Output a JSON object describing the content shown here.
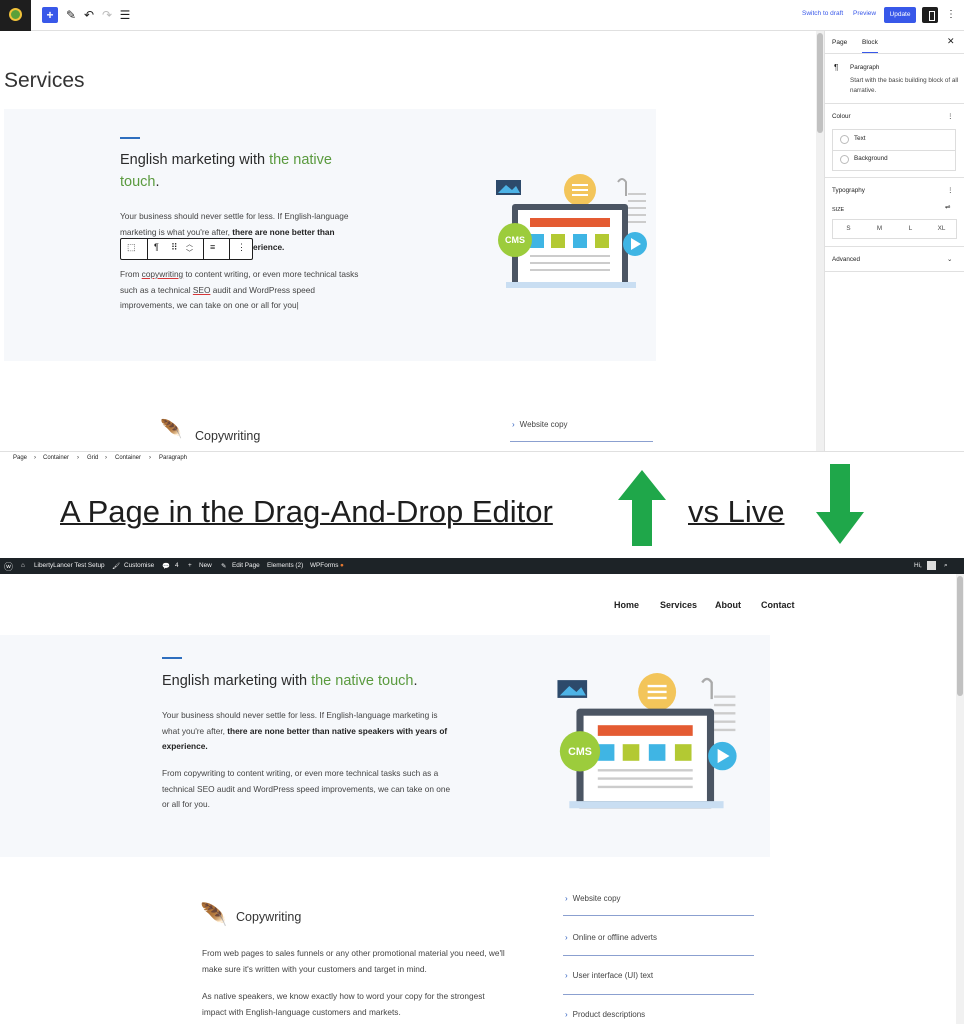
{
  "editor": {
    "toolbar": {
      "add_icon": "plus-icon",
      "switch_to_draft": "Switch to draft",
      "preview": "Preview",
      "update": "Update"
    },
    "page_title": "Services",
    "hero": {
      "heading_part1": "English marketing with ",
      "heading_green": "the native touch",
      "heading_end": ".",
      "para1_start": "Your business should never settle for less. If English-language marketing is what you're after, ",
      "para1_bold": "there are none better than",
      "para1_tail": "erience.",
      "para2_start": "From ",
      "para2_link1": "copywriting",
      "para2_mid1": " to content writing, or even more technical tasks such as a technical ",
      "para2_link2": "SEO",
      "para2_end": " audit and WordPress speed improvements, we can take on one or all for you"
    },
    "section": {
      "heading": "Copywriting",
      "list": [
        "Website copy"
      ]
    },
    "sidebar": {
      "tab_page": "Page",
      "tab_block": "Block",
      "block_name": "Paragraph",
      "block_desc": "Start with the basic building block of all narrative.",
      "colour_label": "Colour",
      "colour_text": "Text",
      "colour_background": "Background",
      "typography_label": "Typography",
      "size_label": "SIZE",
      "sizes": [
        "S",
        "M",
        "L",
        "XL"
      ],
      "advanced_label": "Advanced"
    },
    "breadcrumb": [
      "Page",
      "Container",
      "Grid",
      "Container",
      "Paragraph"
    ]
  },
  "caption": {
    "left": "A Page in the Drag-And-Drop Editor",
    "right": "vs Live",
    "up_color": "#1fa74a",
    "down_color": "#1fa74a"
  },
  "live": {
    "adminbar": {
      "site_name": "LibertyLancer Test Setup",
      "customise": "Customise",
      "comments": "4",
      "new": "New",
      "edit_page": "Edit Page",
      "elements": "Elements (2)",
      "wpforms": "WPForms",
      "greeting": "Hi,"
    },
    "nav": [
      "Home",
      "Services",
      "About",
      "Contact"
    ],
    "hero": {
      "heading_part1": "English marketing with ",
      "heading_green": "the native touch",
      "heading_end": ".",
      "para1_start": "Your business should never settle for less. If English-language marketing is what you're after, ",
      "para1_bold": "there are none better than native speakers with years of experience.",
      "para2": "From copywriting to content writing, or even more technical tasks such as a technical SEO audit and WordPress speed improvements, we can take on one or all for you."
    },
    "section": {
      "heading": "Copywriting",
      "para1": "From web pages to sales funnels or any other promotional material you need, we'll make sure it's written with your customers and target in mind.",
      "para2": "As native speakers, we know exactly how to word your copy for the strongest impact with English-language customers and markets.",
      "list": [
        "Website copy",
        "Online or offline adverts",
        "User interface (UI) text",
        "Product descriptions"
      ]
    }
  },
  "illustration": {
    "badge": "CMS"
  }
}
